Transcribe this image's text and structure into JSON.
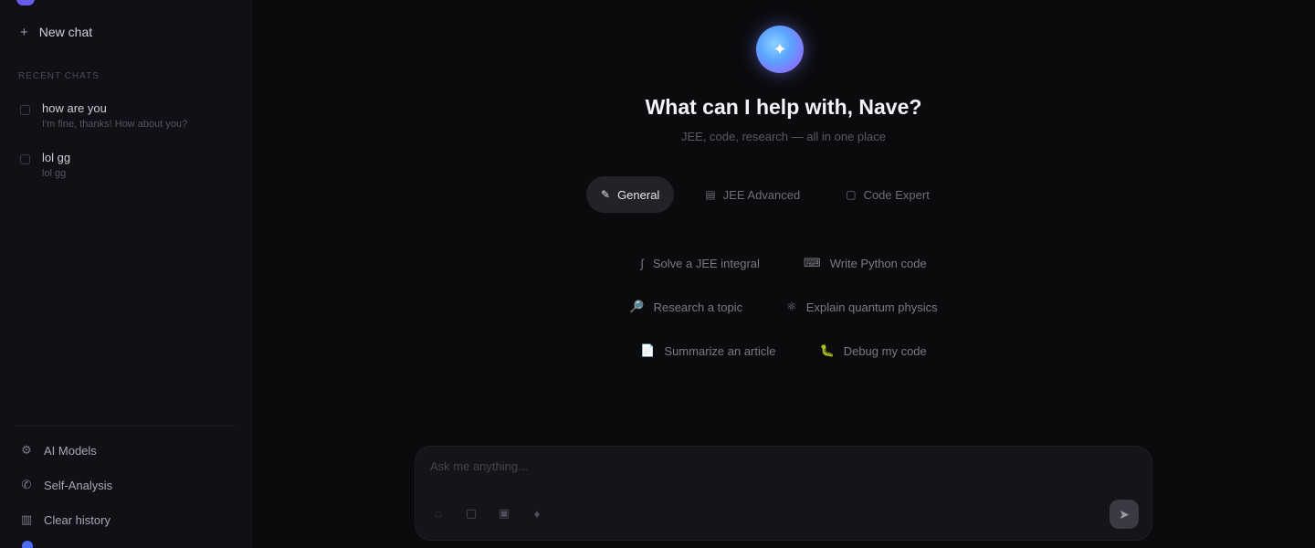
{
  "sidebar": {
    "new_chat_label": "New chat",
    "section_label": "Recent Chats",
    "chats": [
      {
        "title": "how are you",
        "subtitle": "I'm fine, thanks! How about you?"
      },
      {
        "title": "lol gg",
        "subtitle": "lol gg"
      }
    ],
    "bottom": [
      {
        "label": "AI Models",
        "icon": "cpu-icon"
      },
      {
        "label": "Self-Analysis",
        "icon": "phone-icon"
      },
      {
        "label": "Clear history",
        "icon": "trash-icon"
      }
    ]
  },
  "hero": {
    "headline": "What can I help with, Nave?",
    "subline": "JEE, code, research — all in one place"
  },
  "modes": [
    {
      "label": "General",
      "icon": "pencil-icon",
      "active": true
    },
    {
      "label": "JEE Advanced",
      "icon": "book-icon",
      "active": false
    },
    {
      "label": "Code Expert",
      "icon": "code-icon",
      "active": false
    }
  ],
  "suggestions": [
    [
      {
        "emoji": "∫",
        "label": "Solve a JEE integral"
      },
      {
        "emoji": "⌨",
        "label": "Write Python code"
      }
    ],
    [
      {
        "emoji": "🔎",
        "label": "Research a topic"
      },
      {
        "emoji": "⚛",
        "label": "Explain quantum physics"
      }
    ],
    [
      {
        "emoji": "📄",
        "label": "Summarize an article"
      },
      {
        "emoji": "🐛",
        "label": "Debug my code"
      }
    ]
  ],
  "composer": {
    "placeholder": "Ask me anything...",
    "tools": [
      "attach-icon",
      "image-icon",
      "camera-icon",
      "mic-icon"
    ],
    "send_icon": "send-icon"
  },
  "colors": {
    "background": "#0b0b0e",
    "sidebar": "#101016",
    "accent": "#6b5cf0"
  }
}
